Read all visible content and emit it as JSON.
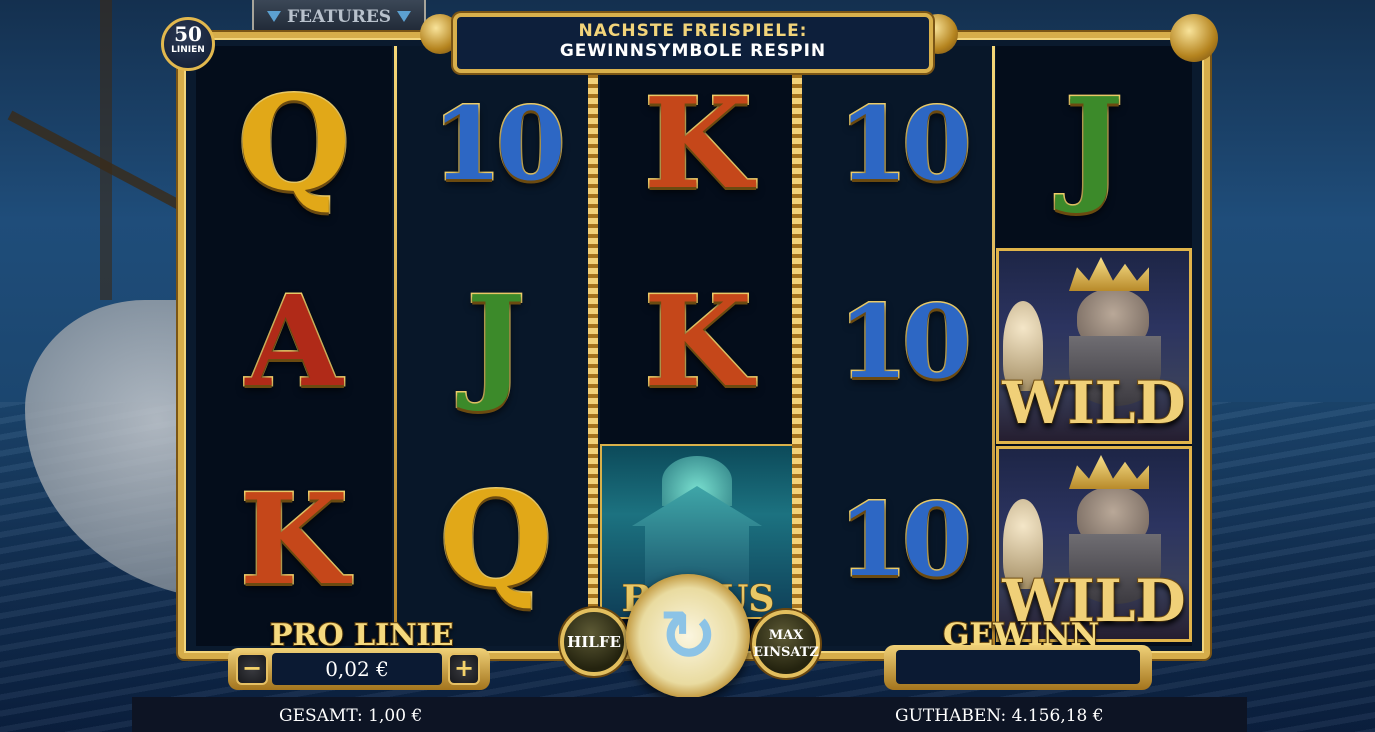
{
  "top": {
    "lines_count": "50",
    "lines_label": "LINIEN",
    "features_label": "FEATURES",
    "banner_line1": "NACHSTE FREISPIELE:",
    "banner_line2": "GEWINNSYMBOLE RESPIN"
  },
  "reels": [
    {
      "symbols": [
        "Q",
        "A",
        "K"
      ]
    },
    {
      "symbols": [
        "10",
        "J",
        "Q"
      ]
    },
    {
      "symbols": [
        "K",
        "K",
        "BONUS"
      ]
    },
    {
      "symbols": [
        "10",
        "10",
        "10"
      ]
    },
    {
      "symbols": [
        "J",
        "WILD",
        "WILD"
      ]
    }
  ],
  "symbol_text": {
    "bonus": "BONUS",
    "wild": "WILD"
  },
  "controls": {
    "pro_linie_label": "PRO LINIE",
    "bet_value": "0,02 €",
    "minus": "−",
    "plus": "+",
    "hilfe": "HILFE",
    "max_einsatz_line1": "MAX",
    "max_einsatz_line2": "EINSATZ",
    "spin_icon": "spin-icon",
    "gewinn_label": "GEWINN",
    "gewinn_value": ""
  },
  "status": {
    "gesamt": "GESAMT: 1,00 €",
    "guthaben": "GUTHABEN: 4.156,18 €"
  },
  "colors": {
    "gold": "#d6ad4a",
    "panel": "#0b1a33",
    "q": "#e1a818",
    "k": "#c5471a",
    "a": "#b02a18",
    "j": "#3c8a2a",
    "ten": "#2d67c4"
  }
}
